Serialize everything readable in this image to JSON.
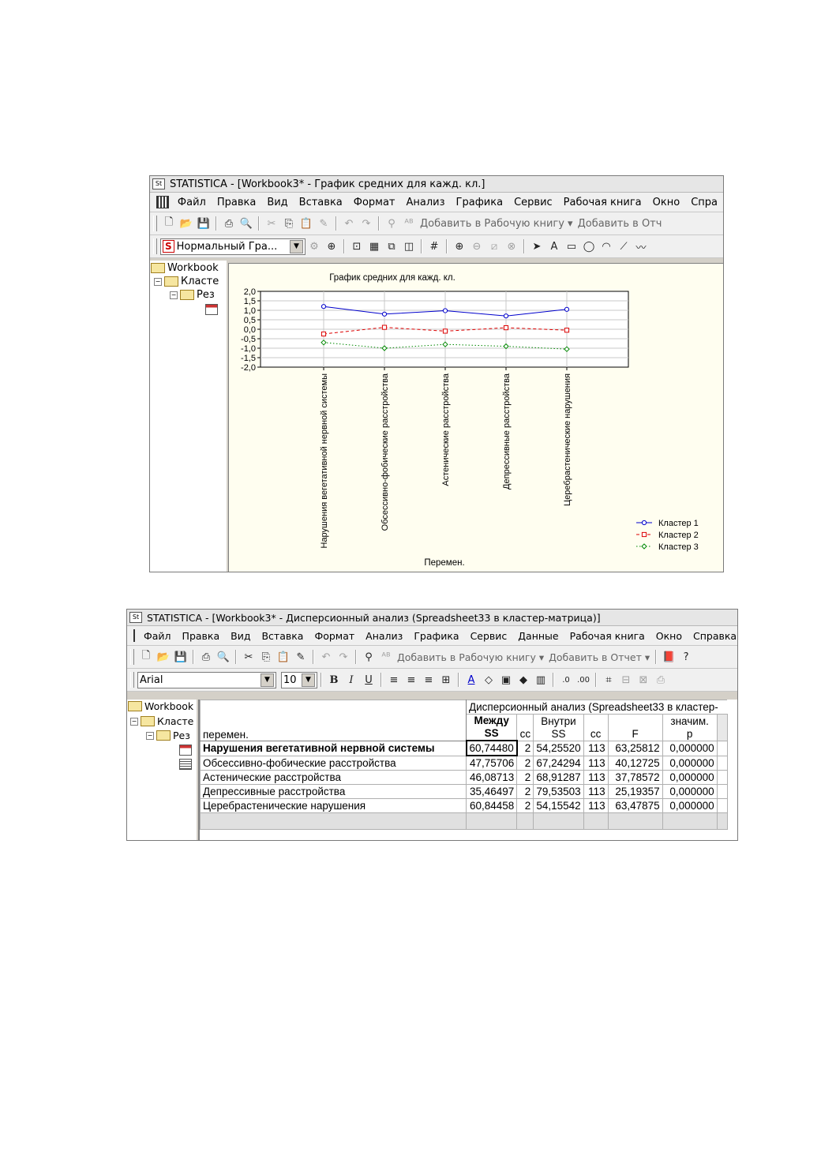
{
  "window1": {
    "title": "STATISTICA - [Workbook3* - График средних для кажд. кл.]",
    "menu": [
      "Файл",
      "Правка",
      "Вид",
      "Вставка",
      "Формат",
      "Анализ",
      "Графика",
      "Сервис",
      "Рабочая книга",
      "Окно",
      "Спра"
    ],
    "toolbar_add_workbook": "Добавить в Рабочую книгу ▾",
    "toolbar_add_report": "Добавить в Отч",
    "style_combo": "Нормальный Гра...",
    "tree": [
      "Workbook",
      "Класте",
      "Рез"
    ],
    "chart": {
      "title": "График средних для кажд. кл.",
      "xlabel": "Перемен.",
      "legend": [
        "Кластер  1",
        "Кластер  2",
        "Кластер  3"
      ],
      "yticks": [
        "2,0",
        "1,5",
        "1,0",
        "0,5",
        "0,0",
        "-0,5",
        "-1,0",
        "-1,5",
        "-2,0"
      ]
    }
  },
  "chart_data": {
    "type": "line",
    "title": "График средних для кажд. кл.",
    "xlabel": "Перемен.",
    "ylabel": "",
    "ylim": [
      -2.0,
      2.0
    ],
    "grid": true,
    "legend_position": "bottom-right",
    "categories": [
      "Нарушения вегетативной нервной системы",
      "Обсессивно-фобические расстройства",
      "Астенические расстройства",
      "Депрессивные расстройства",
      "Церебрастенические нарушения"
    ],
    "series": [
      {
        "name": "Кластер  1",
        "color": "#0000cc",
        "marker": "circle",
        "dash": "solid",
        "values": [
          1.2,
          0.8,
          0.98,
          0.7,
          1.05
        ]
      },
      {
        "name": "Кластер  2",
        "color": "#dd0000",
        "marker": "square",
        "dash": "dashed",
        "values": [
          -0.25,
          0.1,
          -0.1,
          0.08,
          -0.05
        ]
      },
      {
        "name": "Кластер  3",
        "color": "#008800",
        "marker": "diamond",
        "dash": "dotted",
        "values": [
          -0.7,
          -1.0,
          -0.8,
          -0.9,
          -1.05
        ]
      }
    ]
  },
  "window2": {
    "title": "STATISTICA - [Workbook3* - Дисперсионный анализ (Spreadsheet33 в кластер-матрица)]",
    "menu": [
      "Файл",
      "Правка",
      "Вид",
      "Вставка",
      "Формат",
      "Анализ",
      "Графика",
      "Сервис",
      "Данные",
      "Рабочая книга",
      "Окно",
      "Справка"
    ],
    "toolbar_add_workbook": "Добавить в Рабочую книгу ▾",
    "toolbar_add_report": "Добавить в Отчет ▾",
    "font_name": "Arial",
    "font_size": "10",
    "tree": [
      "Workbook",
      "Класте",
      "Рез"
    ],
    "table": {
      "caption": "Дисперсионный анализ (Spreadsheet33 в кластер-",
      "row_header": "перемен.",
      "columns": [
        {
          "l1": "Между",
          "l2": "SS"
        },
        {
          "l1": "сс",
          "l2": ""
        },
        {
          "l1": "Внутри",
          "l2": "SS"
        },
        {
          "l1": "сс",
          "l2": ""
        },
        {
          "l1": "F",
          "l2": ""
        },
        {
          "l1": "значим.",
          "l2": "p"
        }
      ],
      "rows": [
        {
          "name": "Нарушения вегетативной нервной системы",
          "values": [
            "60,74480",
            "2",
            "54,25520",
            "113",
            "63,25812",
            "0,000000"
          ]
        },
        {
          "name": "Обсессивно-фобические расстройства",
          "values": [
            "47,75706",
            "2",
            "67,24294",
            "113",
            "40,12725",
            "0,000000"
          ]
        },
        {
          "name": "Астенические расстройства",
          "values": [
            "46,08713",
            "2",
            "68,91287",
            "113",
            "37,78572",
            "0,000000"
          ]
        },
        {
          "name": "Депрессивные расстройства",
          "values": [
            "35,46497",
            "2",
            "79,53503",
            "113",
            "25,19357",
            "0,000000"
          ]
        },
        {
          "name": "Церебрастенические нарушения",
          "values": [
            "60,84458",
            "2",
            "54,15542",
            "113",
            "63,47875",
            "0,000000"
          ]
        }
      ]
    }
  }
}
